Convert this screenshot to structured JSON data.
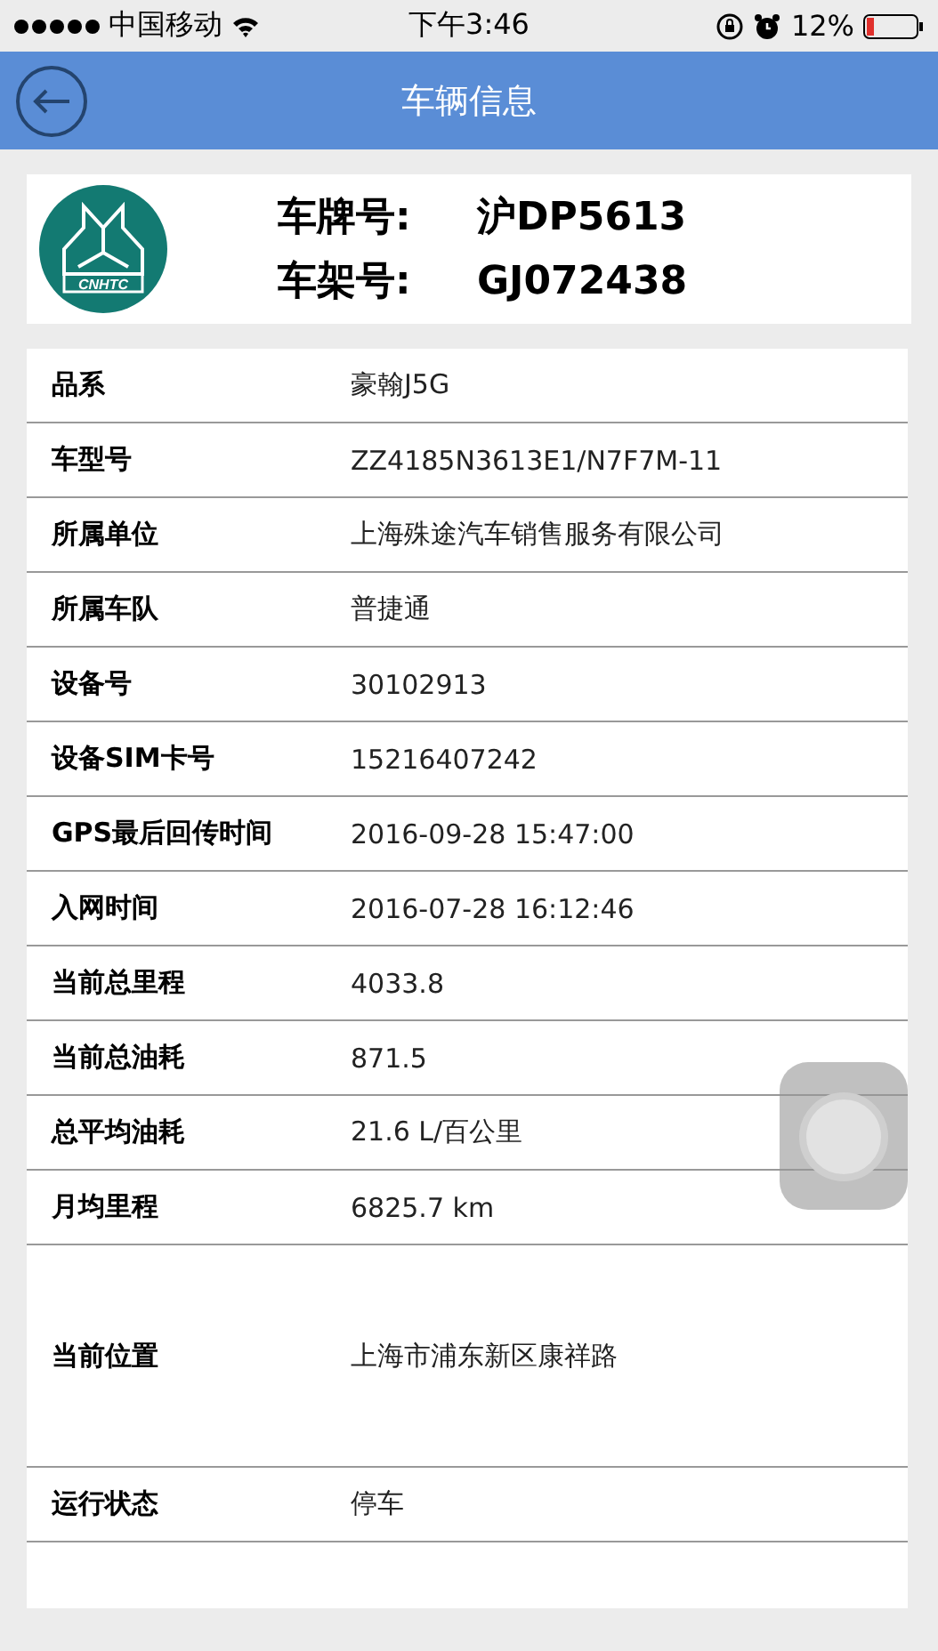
{
  "status_bar": {
    "carrier": "中国移动",
    "time": "下午3:46",
    "battery": "12%"
  },
  "nav": {
    "title": "车辆信息"
  },
  "vehicle": {
    "logo_text": "CNHTC",
    "fields": [
      {
        "label": "车牌号:",
        "value": "沪DP5613"
      },
      {
        "label": "车架号:",
        "value": "GJ072438"
      }
    ]
  },
  "rows": [
    {
      "label": "品系",
      "value": "豪翰J5G"
    },
    {
      "label": "车型号",
      "value": "ZZ4185N3613E1/N7F7M-11"
    },
    {
      "label": "所属单位",
      "value": "上海殊途汽车销售服务有限公司"
    },
    {
      "label": "所属车队",
      "value": "普捷通"
    },
    {
      "label": "设备号",
      "value": "30102913"
    },
    {
      "label": "设备SIM卡号",
      "value": "15216407242"
    },
    {
      "label": "GPS最后回传时间",
      "value": "2016-09-28 15:47:00"
    },
    {
      "label": "入网时间",
      "value": "2016-07-28 16:12:46"
    },
    {
      "label": "当前总里程",
      "value": "4033.8"
    },
    {
      "label": "当前总油耗",
      "value": "871.5"
    },
    {
      "label": "总平均油耗",
      "value": "21.6 L/百公里"
    },
    {
      "label": "月均里程",
      "value": "6825.7 km"
    },
    {
      "label": "当前位置",
      "value": "上海市浦东新区康祥路",
      "kind": "tall"
    },
    {
      "label": "运行状态",
      "value": "停车"
    }
  ]
}
